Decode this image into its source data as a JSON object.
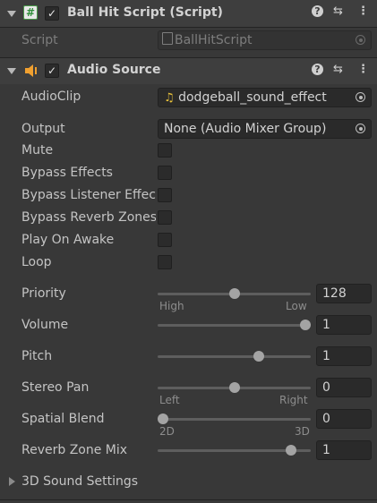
{
  "ball_hit_component": {
    "title": "Ball Hit Script (Script)",
    "enabled": true,
    "script_label": "Script",
    "script_value": "BallHitScript"
  },
  "audio_component": {
    "title": "Audio Source",
    "enabled": true
  },
  "fields": {
    "audioclip_label": "AudioClip",
    "audioclip_value": "dodgeball_sound_effect",
    "output_label": "Output",
    "output_value": "None (Audio Mixer Group)",
    "mute_label": "Mute",
    "bypass_effects_label": "Bypass Effects",
    "bypass_listener_label": "Bypass Listener Effects",
    "bypass_reverb_label": "Bypass Reverb Zones",
    "play_on_awake_label": "Play On Awake",
    "loop_label": "Loop"
  },
  "sliders": {
    "priority": {
      "label": "Priority",
      "value": "128",
      "min_label": "High",
      "max_label": "Low",
      "fraction": 0.5
    },
    "volume": {
      "label": "Volume",
      "value": "1",
      "fraction": 1.0
    },
    "pitch": {
      "label": "Pitch",
      "value": "1",
      "fraction": 0.67
    },
    "stereo_pan": {
      "label": "Stereo Pan",
      "value": "0",
      "min_label": "Left",
      "max_label": "Right",
      "fraction": 0.5
    },
    "spatial_blend": {
      "label": "Spatial Blend",
      "value": "0",
      "min_label": "2D",
      "max_label": "3D",
      "fraction": 0.0
    },
    "reverb_zone_mix": {
      "label": "Reverb Zone Mix",
      "value": "1",
      "fraction": 0.9
    }
  },
  "sound_settings_label": "3D Sound Settings",
  "icons": {
    "help": "?",
    "presets": "⇆",
    "menu": "⋮",
    "check": "✓",
    "script": "#",
    "audio": "🔈",
    "music": "♫"
  },
  "colors": {
    "background": "#383838",
    "header": "#3e3e3e",
    "field": "#2a2a2a",
    "script_icon_green": "#4caf50",
    "audio_icon_orange": "#f0a030",
    "music_icon_yellow": "#e8c13a"
  }
}
